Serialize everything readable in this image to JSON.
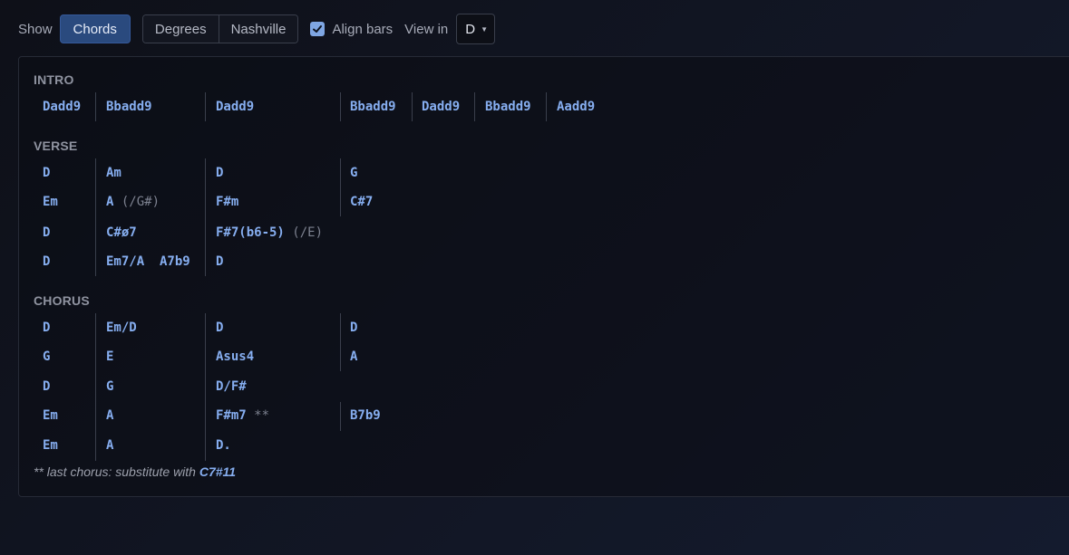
{
  "toolbar": {
    "show_label": "Show",
    "chords_label": "Chords",
    "degrees_label": "Degrees",
    "nashville_label": "Nashville",
    "align_bars_label": "Align bars",
    "align_bars_checked": true,
    "view_in_label": "View in",
    "key_value": "D"
  },
  "sections": {
    "intro": {
      "label": "INTRO",
      "rows": [
        [
          "Dadd9",
          "Bbadd9",
          "Dadd9",
          "Bbadd9",
          "Dadd9",
          "Bbadd9",
          "Aadd9"
        ]
      ]
    },
    "verse": {
      "label": "VERSE",
      "rows": [
        [
          "D",
          "Am",
          "D",
          "G"
        ],
        [
          "Em",
          "A",
          "(/G#)",
          "F#m",
          "C#7"
        ],
        [
          "D",
          "C#ø7",
          "F#7(b6-5)",
          "(/E)"
        ],
        [
          "D",
          "Em7/A",
          "A7b9",
          "D"
        ]
      ]
    },
    "chorus": {
      "label": "CHORUS",
      "rows": [
        [
          "D",
          "Em/D",
          "D",
          "D"
        ],
        [
          "G",
          "E",
          "Asus4",
          "A"
        ],
        [
          "D",
          "G",
          "D/F#"
        ],
        [
          "Em",
          "A",
          "F#m7",
          "**",
          "B7b9"
        ],
        [
          "Em",
          "A",
          "D."
        ]
      ]
    }
  },
  "footnote": {
    "text": "** last chorus: substitute with",
    "chord": "C7#11"
  },
  "colors": {
    "accent": "#2a4a7e",
    "chord": "#86aef0",
    "background": "#111522"
  }
}
